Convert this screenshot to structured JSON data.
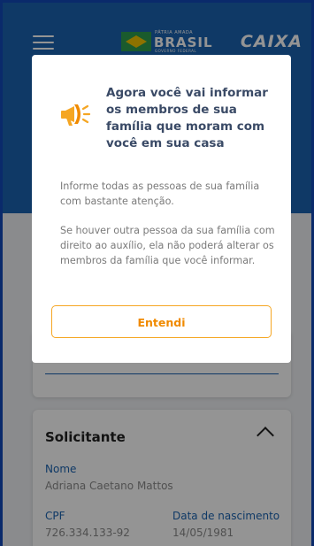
{
  "header": {
    "gov_logo": {
      "top": "PÁTRIA AMADA",
      "main": "BRASIL",
      "bottom": "GOVERNO FEDERAL"
    },
    "caixa_logo": "CAIXA",
    "menu_icon": "hamburger-icon"
  },
  "solicitante": {
    "title": "Solicitante",
    "nome_label": "Nome",
    "nome_value": "Adriana Caetano Mattos",
    "cpf_label": "CPF",
    "cpf_value": "726.334.133-92",
    "nascimento_label": "Data de nascimento",
    "nascimento_value": "14/05/1981"
  },
  "modal": {
    "icon": "megaphone-icon",
    "title": "Agora você vai informar os membros de sua família que moram com você em sua casa",
    "paragraph1": "Informe todas as pessoas de sua família com bastante atenção.",
    "paragraph2": "Se houver outra pessoa da sua família com direito ao auxílio, ela não poderá alterar os membros da família que você informar.",
    "button_label": "Entendi"
  },
  "colors": {
    "primary_blue": "#1b63b0",
    "accent_orange": "#f5a623",
    "frame_dark": "#0a2a6b"
  }
}
